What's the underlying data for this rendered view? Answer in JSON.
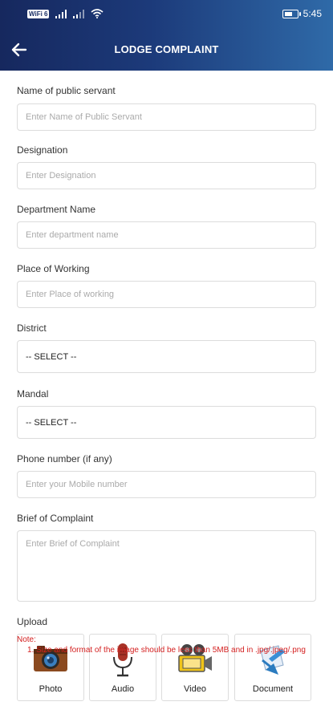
{
  "status_bar": {
    "wifi_badge": "WiFi 6",
    "time": "5:45",
    "battery_level_percent": 60
  },
  "header": {
    "title": "LODGE COMPLAINT",
    "back_icon": "arrow-left-icon"
  },
  "form": {
    "public_servant": {
      "label": "Name of public servant",
      "placeholder": "Enter Name of Public Servant"
    },
    "designation": {
      "label": "Designation",
      "placeholder": "Enter Designation"
    },
    "department": {
      "label": "Department Name",
      "placeholder": "Enter department name"
    },
    "place": {
      "label": "Place of Working",
      "placeholder": "Enter Place of working"
    },
    "district": {
      "label": "District",
      "selected": "-- SELECT --"
    },
    "mandal": {
      "label": "Mandal",
      "selected": "-- SELECT --"
    },
    "phone": {
      "label": "Phone number (if any)",
      "placeholder": "Enter your Mobile number"
    },
    "brief": {
      "label": "Brief of Complaint",
      "placeholder": "Enter Brief of Complaint"
    }
  },
  "upload": {
    "label": "Upload",
    "items": [
      {
        "label": "Photo",
        "icon": "camera-icon"
      },
      {
        "label": "Audio",
        "icon": "microphone-icon"
      },
      {
        "label": "Video",
        "icon": "video-camera-icon"
      },
      {
        "label": "Document",
        "icon": "document-icon"
      }
    ]
  },
  "note": {
    "title": "Note:",
    "items": [
      "1. Size and format of the image should be less than 5MB and in .jpg/.jpeg/.png"
    ]
  },
  "colors": {
    "header_dark": "#16285e",
    "header_light": "#2f6aa8",
    "note_red": "#d42020"
  }
}
